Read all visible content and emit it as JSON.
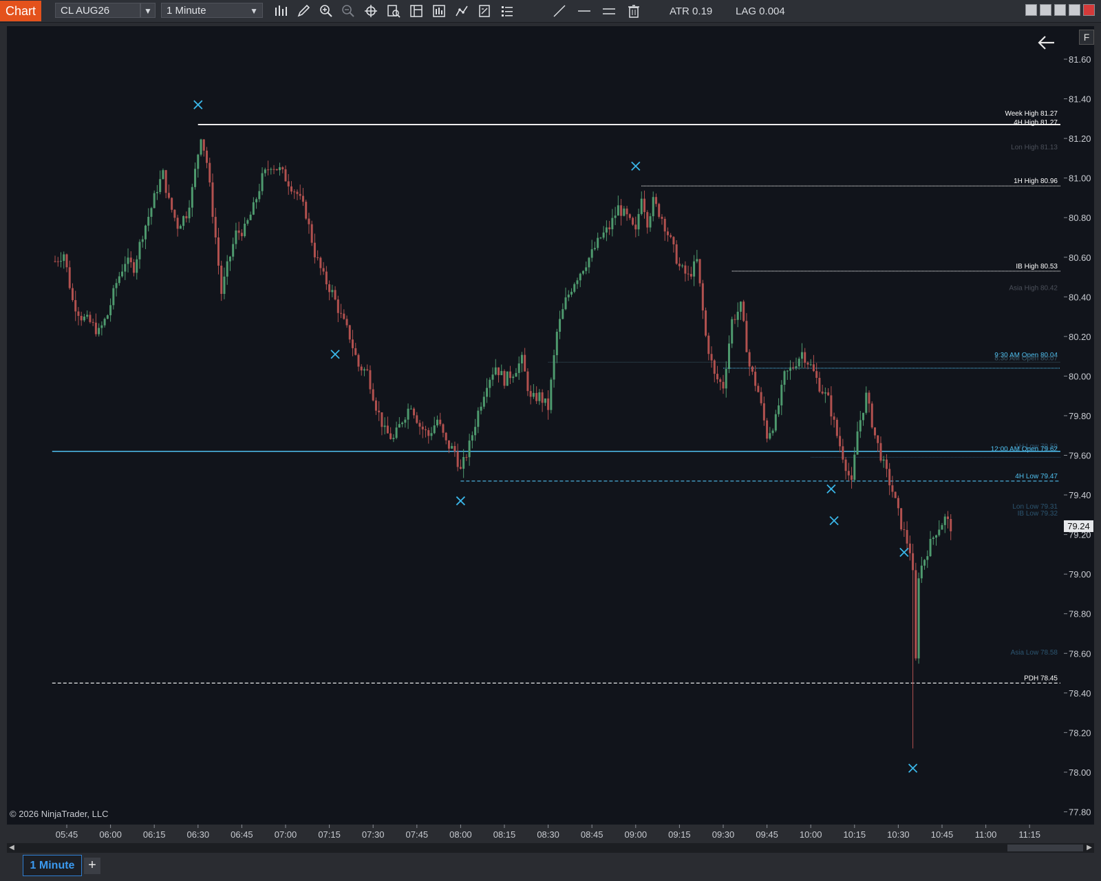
{
  "toolbar": {
    "badge": "Chart",
    "instrument": "CL AUG26",
    "interval": "1 Minute",
    "atr": "ATR 0.19",
    "lag": "LAG 0.004",
    "icons": [
      "bar-type-icon",
      "pencil-icon",
      "zoom-in-icon",
      "zoom-out-icon",
      "crosshair-icon",
      "data-box-icon",
      "chart-properties-icon",
      "strategies-icon",
      "drawing-tools-icon",
      "template-icon",
      "list-icon",
      "line-tool-icon",
      "horizontal-line-icon",
      "double-line-icon",
      "trash-icon"
    ]
  },
  "chart": {
    "f_button": "F",
    "copyright": "© 2026 NinjaTrader, LLC",
    "current_price": "79.24",
    "back_icon": "arrow-left-icon"
  },
  "chart_data": {
    "type": "candlestick",
    "instrument": "CL AUG26",
    "interval": "1 Minute",
    "x_ticks": [
      "05:45",
      "06:00",
      "06:15",
      "06:30",
      "06:45",
      "07:00",
      "07:15",
      "07:30",
      "07:45",
      "08:00",
      "08:15",
      "08:30",
      "08:45",
      "09:00",
      "09:15",
      "09:30",
      "09:45",
      "10:00",
      "10:15",
      "10:30",
      "10:45",
      "11:00",
      "11:15"
    ],
    "y_ticks": [
      "81.60",
      "81.40",
      "81.20",
      "81.00",
      "80.80",
      "80.60",
      "80.40",
      "80.20",
      "80.00",
      "79.80",
      "79.60",
      "79.40",
      "79.20",
      "79.00",
      "78.80",
      "78.60",
      "78.40",
      "78.20",
      "78.00",
      "77.80"
    ],
    "ylim": [
      77.75,
      81.75
    ],
    "current_price": 79.24,
    "price_path": [
      [
        "05:41",
        80.58
      ],
      [
        "05:44",
        80.62
      ],
      [
        "05:47",
        80.38
      ],
      [
        "05:50",
        80.3
      ],
      [
        "05:53",
        80.27
      ],
      [
        "05:56",
        80.22
      ],
      [
        "05:59",
        80.31
      ],
      [
        "06:02",
        80.47
      ],
      [
        "06:05",
        80.58
      ],
      [
        "06:08",
        80.55
      ],
      [
        "06:11",
        80.72
      ],
      [
        "06:14",
        80.85
      ],
      [
        "06:16",
        80.95
      ],
      [
        "06:18",
        81.02
      ],
      [
        "06:20",
        80.88
      ],
      [
        "06:23",
        80.76
      ],
      [
        "06:26",
        80.82
      ],
      [
        "06:28",
        80.94
      ],
      [
        "06:31",
        81.22
      ],
      [
        "06:33",
        81.08
      ],
      [
        "06:36",
        80.7
      ],
      [
        "06:38",
        80.42
      ],
      [
        "06:40",
        80.55
      ],
      [
        "06:43",
        80.72
      ],
      [
        "06:46",
        80.74
      ],
      [
        "06:49",
        80.85
      ],
      [
        "06:52",
        81.0
      ],
      [
        "06:55",
        81.07
      ],
      [
        "06:58",
        81.04
      ],
      [
        "07:01",
        80.98
      ],
      [
        "07:04",
        80.92
      ],
      [
        "07:07",
        80.82
      ],
      [
        "07:10",
        80.62
      ],
      [
        "07:13",
        80.5
      ],
      [
        "07:16",
        80.42
      ],
      [
        "07:19",
        80.3
      ],
      [
        "07:22",
        80.2
      ],
      [
        "07:25",
        80.05
      ],
      [
        "07:28",
        80.02
      ],
      [
        "07:31",
        79.85
      ],
      [
        "07:34",
        79.72
      ],
      [
        "07:37",
        79.68
      ],
      [
        "07:40",
        79.78
      ],
      [
        "07:43",
        79.86
      ],
      [
        "07:46",
        79.75
      ],
      [
        "07:49",
        79.7
      ],
      [
        "07:52",
        79.78
      ],
      [
        "07:55",
        79.66
      ],
      [
        "07:58",
        79.62
      ],
      [
        "08:00",
        79.52
      ],
      [
        "08:03",
        79.65
      ],
      [
        "08:06",
        79.82
      ],
      [
        "08:09",
        79.97
      ],
      [
        "08:12",
        80.05
      ],
      [
        "08:15",
        79.98
      ],
      [
        "08:18",
        80.02
      ],
      [
        "08:21",
        80.08
      ],
      [
        "08:24",
        79.88
      ],
      [
        "08:27",
        79.9
      ],
      [
        "08:30",
        79.84
      ],
      [
        "08:33",
        80.22
      ],
      [
        "08:36",
        80.38
      ],
      [
        "08:39",
        80.48
      ],
      [
        "08:42",
        80.55
      ],
      [
        "08:45",
        80.62
      ],
      [
        "08:48",
        80.7
      ],
      [
        "08:51",
        80.75
      ],
      [
        "08:54",
        80.85
      ],
      [
        "08:57",
        80.8
      ],
      [
        "09:00",
        80.72
      ],
      [
        "09:02",
        80.92
      ],
      [
        "09:04",
        80.78
      ],
      [
        "09:06",
        80.88
      ],
      [
        "09:09",
        80.8
      ],
      [
        "09:12",
        80.68
      ],
      [
        "09:15",
        80.55
      ],
      [
        "09:18",
        80.5
      ],
      [
        "09:21",
        80.58
      ],
      [
        "09:24",
        80.2
      ],
      [
        "09:27",
        80.0
      ],
      [
        "09:30",
        79.95
      ],
      [
        "09:33",
        80.28
      ],
      [
        "09:36",
        80.35
      ],
      [
        "09:39",
        80.05
      ],
      [
        "09:42",
        79.92
      ],
      [
        "09:45",
        79.7
      ],
      [
        "09:48",
        79.78
      ],
      [
        "09:51",
        80.0
      ],
      [
        "09:54",
        80.05
      ],
      [
        "09:57",
        80.12
      ],
      [
        "10:00",
        80.05
      ],
      [
        "10:03",
        79.95
      ],
      [
        "10:06",
        79.88
      ],
      [
        "10:09",
        79.7
      ],
      [
        "10:12",
        79.55
      ],
      [
        "10:14",
        79.45
      ],
      [
        "10:16",
        79.72
      ],
      [
        "10:19",
        79.9
      ],
      [
        "10:22",
        79.7
      ],
      [
        "10:25",
        79.55
      ],
      [
        "10:28",
        79.42
      ],
      [
        "10:31",
        79.25
      ],
      [
        "10:34",
        79.12
      ],
      [
        "10:35",
        78.12
      ],
      [
        "10:37",
        79.0
      ],
      [
        "10:40",
        79.12
      ],
      [
        "10:43",
        79.22
      ],
      [
        "10:46",
        79.28
      ],
      [
        "10:48",
        79.24
      ]
    ],
    "levels": [
      {
        "label": "Week High",
        "value": "81.27",
        "color": "#ffffff",
        "style": "solid",
        "start": "06:30"
      },
      {
        "label": "4H High",
        "value": "81.27",
        "color": "#ffffff",
        "style": "solid",
        "start": "06:30"
      },
      {
        "label": "Lon High",
        "value": "81.13",
        "color": "#4b505a",
        "style": "none",
        "start": "11:15"
      },
      {
        "label": "1H High",
        "value": "80.96",
        "color": "#ffffff",
        "style": "dotted",
        "start": "09:02"
      },
      {
        "label": "IB High",
        "value": "80.53",
        "color": "#ffffff",
        "style": "dotted",
        "start": "09:33"
      },
      {
        "label": "Asia High",
        "value": "80.42",
        "color": "#4b505a",
        "style": "none",
        "start": "11:15"
      },
      {
        "label": "9:30 AM Open",
        "value": "80.04",
        "color": "#4fc0f0",
        "style": "dotted",
        "start": "09:30"
      },
      {
        "label": "8:30 AM Open",
        "value": "80.07",
        "color": "#3c5a6a",
        "style": "dotted",
        "start": "08:30"
      },
      {
        "label": "1H Low",
        "value": "79.59",
        "color": "#2c5570",
        "style": "dotted",
        "start": "10:00"
      },
      {
        "label": "12:00 AM Open",
        "value": "79.62",
        "color": "#4fc0f0",
        "style": "solid",
        "start": "05:40"
      },
      {
        "label": "4H Low",
        "value": "79.47",
        "color": "#4fc0f0",
        "style": "dashed",
        "start": "08:00"
      },
      {
        "label": "Lon Low",
        "value": "79.31",
        "color": "#2c5570",
        "style": "none",
        "start": "11:15"
      },
      {
        "label": "IB Low",
        "value": "79.32",
        "color": "#2c5570",
        "style": "none",
        "start": "11:15"
      },
      {
        "label": "Asia Low",
        "value": "78.58",
        "color": "#2c5570",
        "style": "none",
        "start": "11:15"
      },
      {
        "label": "PDH",
        "value": "78.45",
        "color": "#ffffff",
        "style": "dashed",
        "start": "05:40"
      }
    ],
    "markers": [
      [
        "06:30",
        81.37
      ],
      [
        "07:17",
        80.11
      ],
      [
        "08:00",
        79.37
      ],
      [
        "09:00",
        81.06
      ],
      [
        "10:07",
        79.43
      ],
      [
        "10:08",
        79.27
      ],
      [
        "10:32",
        79.11
      ],
      [
        "10:35",
        78.02
      ]
    ],
    "colors": {
      "up": "#4e9a6e",
      "down": "#b2514f",
      "marker": "#3ab6e8",
      "background": "#11141b"
    }
  },
  "tabs": [
    {
      "label": "1 Minute",
      "active": true
    }
  ],
  "add_tab": "+"
}
